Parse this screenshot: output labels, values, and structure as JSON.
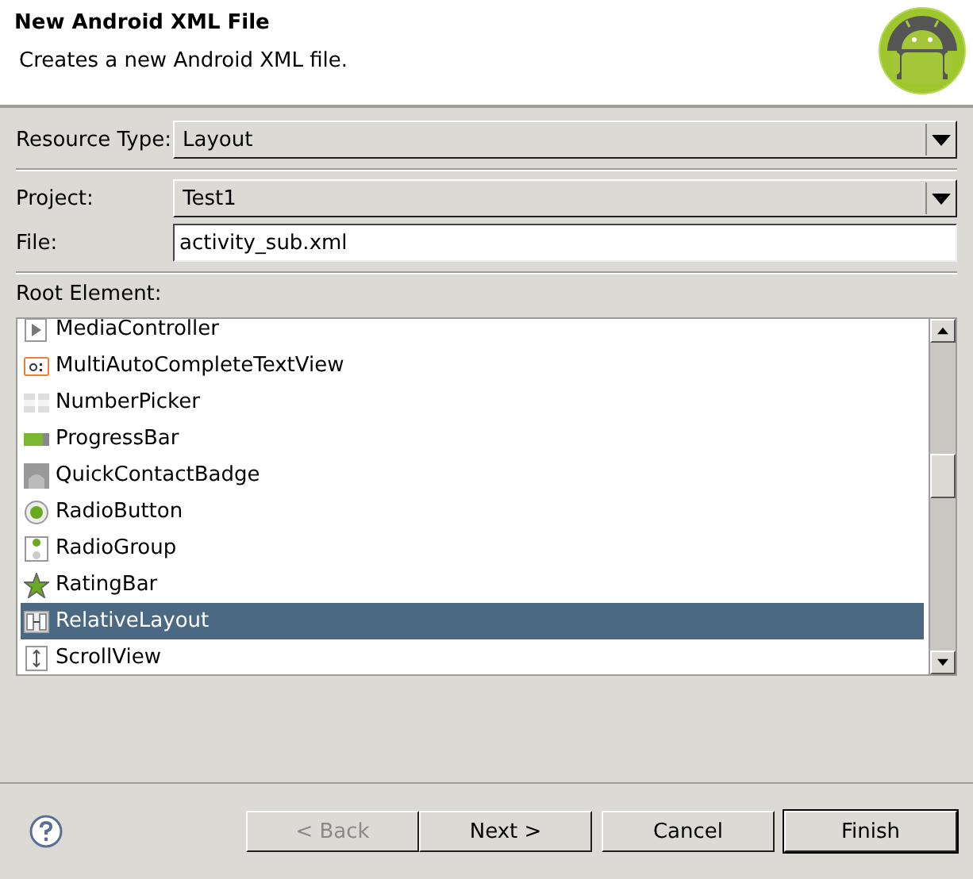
{
  "header": {
    "title": "New Android XML File",
    "description": "Creates a new Android XML file."
  },
  "form": {
    "resource_type": {
      "label": "Resource Type:",
      "value": "Layout"
    },
    "project": {
      "label": "Project:",
      "value": "Test1"
    },
    "file": {
      "label": "File:",
      "value": "activity_sub.xml"
    }
  },
  "root_element": {
    "label": "Root Element:",
    "items": [
      {
        "label": "MediaController",
        "kind": "media",
        "selected": false
      },
      {
        "label": "MultiAutoCompleteTextView",
        "kind": "autocomplete",
        "selected": false
      },
      {
        "label": "NumberPicker",
        "kind": "picker",
        "selected": false
      },
      {
        "label": "ProgressBar",
        "kind": "progress",
        "selected": false
      },
      {
        "label": "QuickContactBadge",
        "kind": "badge",
        "selected": false
      },
      {
        "label": "RadioButton",
        "kind": "radio",
        "selected": false
      },
      {
        "label": "RadioGroup",
        "kind": "radiogroup",
        "selected": false
      },
      {
        "label": "RatingBar",
        "kind": "rating",
        "selected": false
      },
      {
        "label": "RelativeLayout",
        "kind": "relative",
        "selected": true
      },
      {
        "label": "ScrollView",
        "kind": "scroll",
        "selected": false
      }
    ]
  },
  "buttons": [
    {
      "label": "< Back",
      "disabled": true
    },
    {
      "label": "Next >",
      "disabled": false
    },
    {
      "label": "Cancel",
      "disabled": false
    },
    {
      "label": "Finish",
      "disabled": false,
      "default": true
    }
  ]
}
